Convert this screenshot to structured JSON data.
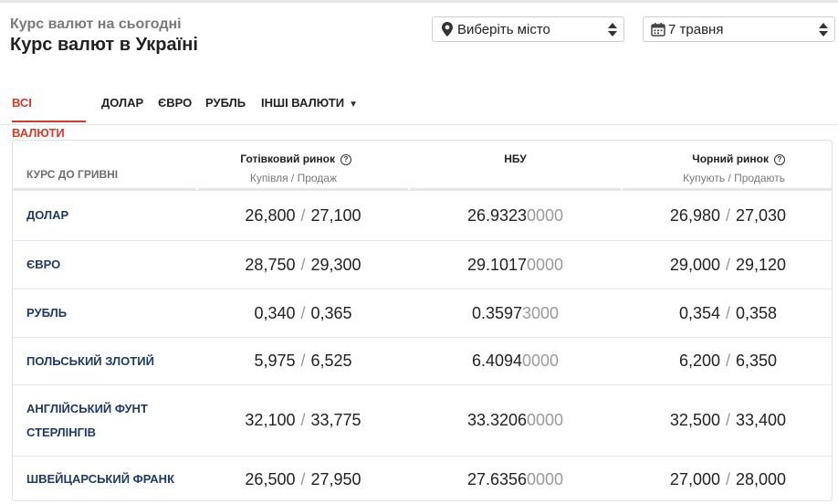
{
  "header": {
    "subtitle": "Курс валют на сьогодні",
    "title": "Курс валют в Україні",
    "city_select": {
      "label": "Виберіть місто",
      "icon": "map-pin-icon"
    },
    "date_select": {
      "label": "7 травня",
      "icon": "calendar-icon"
    }
  },
  "tabs": [
    {
      "label": "ВСІ ВАЛЮТИ",
      "active": true
    },
    {
      "label": "ДОЛАР",
      "active": false
    },
    {
      "label": "ЄВРО",
      "active": false
    },
    {
      "label": "РУБЛЬ",
      "active": false
    },
    {
      "label": "ІНШІ ВАЛЮТИ",
      "active": false,
      "dropdown_caret": "▼"
    }
  ],
  "table": {
    "columns": [
      {
        "title": "КУРС ДО ГРИВНІ"
      },
      {
        "title": "Готівковий ринок",
        "subtitle": "Купівля / Продаж",
        "help": "?"
      },
      {
        "title": "НБУ"
      },
      {
        "title": "Чорний ринок",
        "subtitle": "Купують / Продають",
        "help": "?"
      }
    ],
    "separator": "/",
    "rows": [
      {
        "name": "ДОЛАР",
        "cash_buy": "26,800",
        "cash_sell": "27,100",
        "nbu_main": "26.9323",
        "nbu_tail": "0000",
        "black_buy": "26,980",
        "black_sell": "27,030"
      },
      {
        "name": "ЄВРО",
        "cash_buy": "28,750",
        "cash_sell": "29,300",
        "nbu_main": "29.1017",
        "nbu_tail": "0000",
        "black_buy": "29,000",
        "black_sell": "29,120"
      },
      {
        "name": "РУБЛЬ",
        "cash_buy": "0,340",
        "cash_sell": "0,365",
        "nbu_main": "0.3597",
        "nbu_tail": "3000",
        "black_buy": "0,354",
        "black_sell": "0,358"
      },
      {
        "name": "ПОЛЬСЬКИЙ ЗЛОТИЙ",
        "cash_buy": "5,975",
        "cash_sell": "6,525",
        "nbu_main": "6.4094",
        "nbu_tail": "0000",
        "black_buy": "6,200",
        "black_sell": "6,350"
      },
      {
        "name": "АНГЛІЙСЬКИЙ ФУНТ СТЕРЛІНГІВ",
        "cash_buy": "32,100",
        "cash_sell": "33,775",
        "nbu_main": "33.3206",
        "nbu_tail": "0000",
        "black_buy": "32,500",
        "black_sell": "33,400"
      },
      {
        "name": "ШВЕЙЦАРСЬКИЙ ФРАНК",
        "cash_buy": "26,500",
        "cash_sell": "27,950",
        "nbu_main": "27.6356",
        "nbu_tail": "0000",
        "black_buy": "27,000",
        "black_sell": "28,000"
      }
    ]
  },
  "colors": {
    "accent": "#d8392b",
    "currency_name": "#1f3a63",
    "muted": "#9a9a9a"
  }
}
